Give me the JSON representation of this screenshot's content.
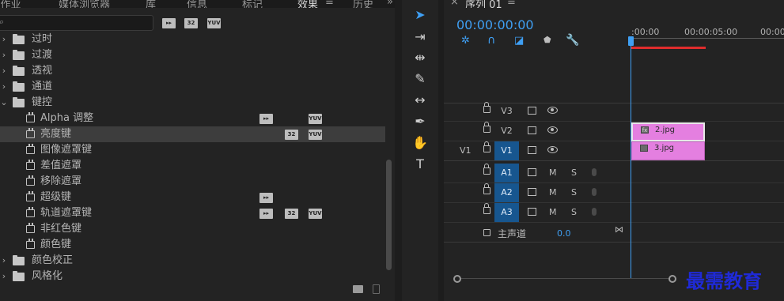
{
  "effects_panel": {
    "tabs": [
      {
        "label": ": 作业",
        "active": false
      },
      {
        "label": "媒体浏览器",
        "active": false
      },
      {
        "label": "库",
        "active": false
      },
      {
        "label": "信息",
        "active": false
      },
      {
        "label": "标记",
        "active": false
      },
      {
        "label": "效果",
        "active": true
      },
      {
        "label": "历史",
        "active": false
      }
    ],
    "menu_icon": "hamburger-icon",
    "more_icon": "chevron-double-right-icon",
    "search_placeholder": "",
    "filter_badges": [
      "▸▸",
      "32",
      "YUV"
    ],
    "tree": [
      {
        "kind": "folder",
        "expanded": false,
        "label": "过时"
      },
      {
        "kind": "folder",
        "expanded": false,
        "label": "过渡"
      },
      {
        "kind": "folder",
        "expanded": false,
        "label": "透视"
      },
      {
        "kind": "folder",
        "expanded": false,
        "label": "通道"
      },
      {
        "kind": "folder",
        "expanded": true,
        "label": "键控"
      },
      {
        "kind": "effect",
        "label": "Alpha 调整",
        "accel": true,
        "b32": false,
        "yuv": true,
        "selected": false
      },
      {
        "kind": "effect",
        "label": "亮度键",
        "accel": false,
        "b32": true,
        "yuv": true,
        "selected": true
      },
      {
        "kind": "effect",
        "label": "图像遮罩键",
        "accel": false,
        "b32": false,
        "yuv": false,
        "selected": false
      },
      {
        "kind": "effect",
        "label": "差值遮罩",
        "accel": false,
        "b32": false,
        "yuv": false,
        "selected": false
      },
      {
        "kind": "effect",
        "label": "移除遮罩",
        "accel": false,
        "b32": false,
        "yuv": false,
        "selected": false
      },
      {
        "kind": "effect",
        "label": "超级键",
        "accel": true,
        "b32": false,
        "yuv": false,
        "selected": false
      },
      {
        "kind": "effect",
        "label": "轨道遮罩键",
        "accel": true,
        "b32": true,
        "yuv": true,
        "selected": false
      },
      {
        "kind": "effect",
        "label": "非红色键",
        "accel": false,
        "b32": false,
        "yuv": false,
        "selected": false
      },
      {
        "kind": "effect",
        "label": "颜色键",
        "accel": false,
        "b32": false,
        "yuv": false,
        "selected": false
      },
      {
        "kind": "folder",
        "expanded": false,
        "label": "颜色校正"
      },
      {
        "kind": "folder",
        "expanded": false,
        "label": "风格化"
      }
    ]
  },
  "tools": [
    {
      "name": "selection-tool-icon",
      "glyph": "➤",
      "active": true
    },
    {
      "name": "track-select-tool-icon",
      "glyph": "⇥",
      "active": false
    },
    {
      "name": "ripple-edit-tool-icon",
      "glyph": "⇹",
      "active": false
    },
    {
      "name": "razor-tool-icon",
      "glyph": "✎",
      "active": false
    },
    {
      "name": "slip-tool-icon",
      "glyph": "↔",
      "active": false
    },
    {
      "name": "pen-tool-icon",
      "glyph": "✒",
      "active": false
    },
    {
      "name": "hand-tool-icon",
      "glyph": "✋",
      "active": false
    },
    {
      "name": "type-tool-icon",
      "glyph": "T",
      "active": false
    }
  ],
  "timeline": {
    "close": "×",
    "sequence_tab": "序列 01",
    "menu": "≡",
    "timecode": "00:00:00:00",
    "ruler": [
      ":00:00",
      "00:00:05:00",
      "00:00"
    ],
    "video_tracks": [
      {
        "name": "V3",
        "source": "",
        "on": false
      },
      {
        "name": "V2",
        "source": "",
        "on": false
      },
      {
        "name": "V1",
        "source": "V1",
        "on": true
      }
    ],
    "audio_tracks": [
      {
        "name": "A1",
        "source": "",
        "on": true
      },
      {
        "name": "A2",
        "source": "",
        "on": true
      },
      {
        "name": "A3",
        "source": "",
        "on": true
      }
    ],
    "audio_ms": [
      "M",
      "S"
    ],
    "master_label": "主声道",
    "master_value": "0.0",
    "clips": [
      {
        "track": "V2",
        "label": "2.jpg",
        "fx": "fx"
      },
      {
        "track": "V1",
        "label": "3.jpg",
        "fx": ""
      }
    ],
    "accent": "#3f9ff3",
    "clip_color": "#e47fe0",
    "workarea_color": "#e02d2d"
  },
  "watermark": "最需教育"
}
